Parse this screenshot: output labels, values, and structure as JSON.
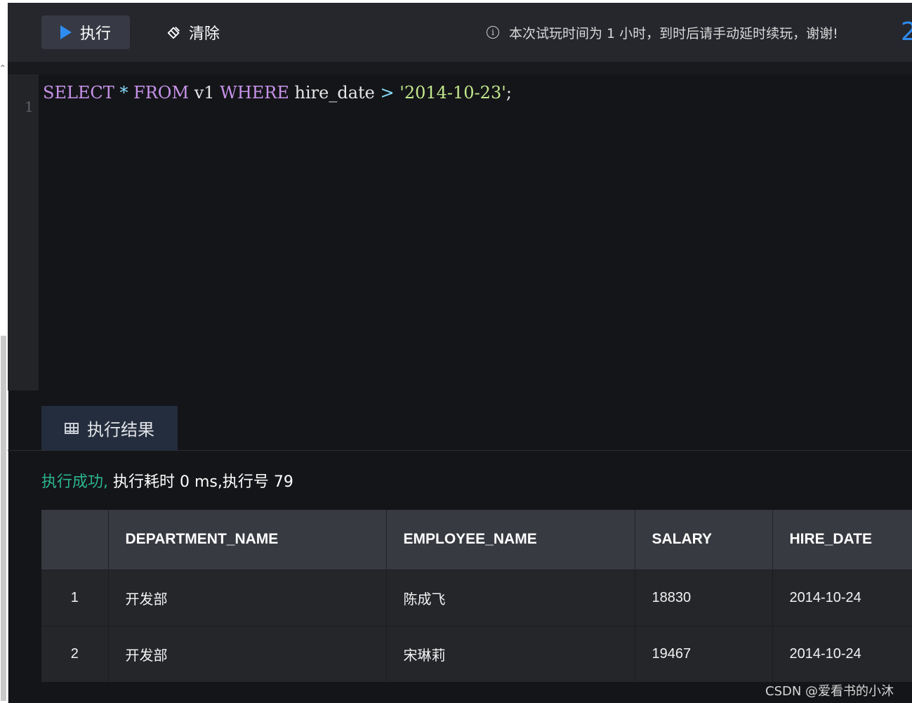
{
  "toolbar": {
    "run_label": "执行",
    "clear_label": "清除",
    "notice": "本次试玩时间为 1 小时，到时后请手动延时续玩，谢谢!",
    "cutoff_text": "2"
  },
  "editor": {
    "line_number": "1",
    "tokens": {
      "select": "SELECT",
      "star": "*",
      "from": "FROM",
      "table": "v1",
      "where": "WHERE",
      "column": "hire_date",
      "op": ">",
      "literal": "'2014-10-23'",
      "semi": ";"
    }
  },
  "results": {
    "tab_label": "执行结果",
    "status_ok": "执行成功,",
    "status_detail": " 执行耗时 0 ms,执行号 79",
    "columns": [
      "DEPARTMENT_NAME",
      "EMPLOYEE_NAME",
      "SALARY",
      "HIRE_DATE"
    ],
    "rows": [
      {
        "index": "1",
        "department_name": "开发部",
        "employee_name": "陈成飞",
        "salary": "18830",
        "hire_date": "2014-10-24"
      },
      {
        "index": "2",
        "department_name": "开发部",
        "employee_name": "宋琳莉",
        "salary": "19467",
        "hire_date": "2014-10-24"
      }
    ]
  },
  "watermark": "CSDN @爱看书的小沐",
  "colors": {
    "accent_blue": "#2e8cf0",
    "success_green": "#2bb58f",
    "keyword_purple": "#c792ea",
    "string_green": "#c3e88d"
  }
}
